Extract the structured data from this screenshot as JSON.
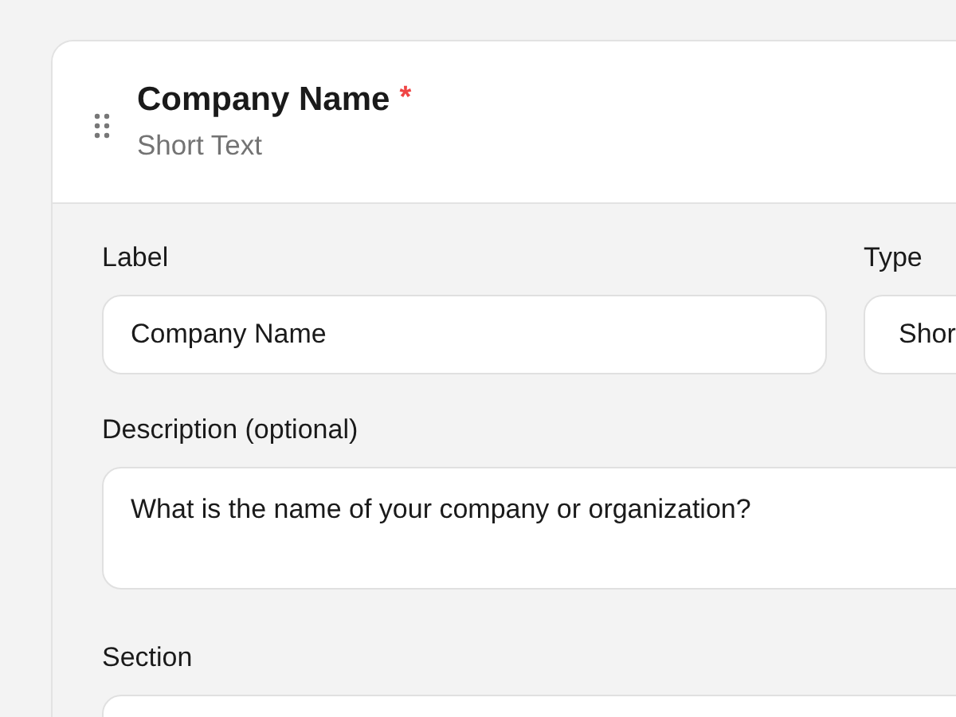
{
  "field_card": {
    "title": "Company Name",
    "required_mark": "*",
    "subtitle": "Short Text"
  },
  "form": {
    "label": {
      "label": "Label",
      "value": "Company Name"
    },
    "type": {
      "label": "Type",
      "value": "Shor"
    },
    "description": {
      "label": "Description (optional)",
      "value": "What is the name of your company or organization?"
    },
    "section": {
      "label": "Section"
    }
  }
}
